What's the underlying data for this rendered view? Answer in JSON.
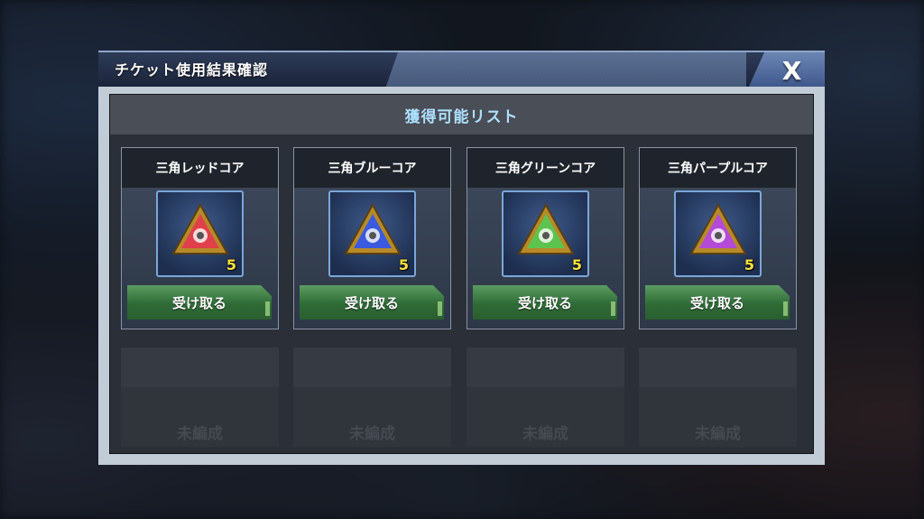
{
  "dialog": {
    "title": "チケット使用結果確認",
    "close_label": "X"
  },
  "panel": {
    "header": "獲得可能リスト"
  },
  "rewards": [
    {
      "name": "三角レッドコア",
      "count": "5",
      "button": "受け取る",
      "color": "#e0404a",
      "icon": "triangle-core-red-icon"
    },
    {
      "name": "三角ブルーコア",
      "count": "5",
      "button": "受け取る",
      "color": "#3a5ae0",
      "icon": "triangle-core-blue-icon"
    },
    {
      "name": "三角グリーンコア",
      "count": "5",
      "button": "受け取る",
      "color": "#5cc44e",
      "icon": "triangle-core-green-icon"
    },
    {
      "name": "三角パープルコア",
      "count": "5",
      "button": "受け取る",
      "color": "#b44ad8",
      "icon": "triangle-core-purple-icon"
    }
  ],
  "empty_slots": [
    {
      "label": "未編成"
    },
    {
      "label": "未編成"
    },
    {
      "label": "未編成"
    },
    {
      "label": "未編成"
    }
  ]
}
